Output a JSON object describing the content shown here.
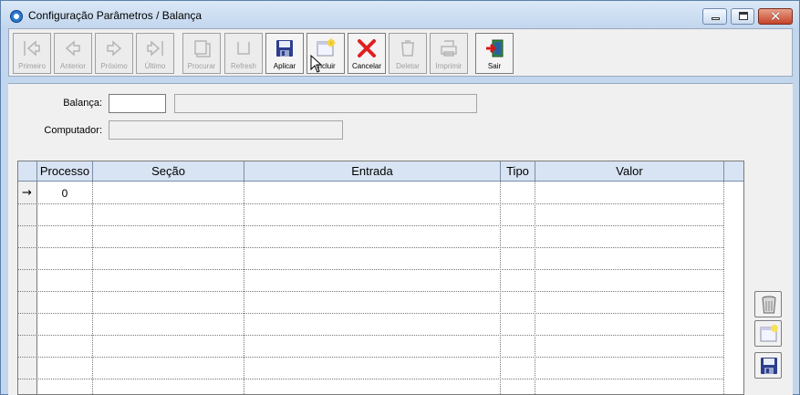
{
  "window": {
    "title": "Configuração Parâmetros / Balança"
  },
  "toolbar": {
    "buttons": [
      {
        "label": "Primeiro",
        "icon": "first-icon",
        "enabled": false
      },
      {
        "label": "Anterior",
        "icon": "previous-icon",
        "enabled": false
      },
      {
        "label": "Próximo",
        "icon": "next-icon",
        "enabled": false
      },
      {
        "label": "Último",
        "icon": "last-icon",
        "enabled": false
      },
      {
        "label": "Procurar",
        "icon": "search-icon",
        "enabled": false
      },
      {
        "label": "Refresh",
        "icon": "refresh-icon",
        "enabled": false
      },
      {
        "label": "Aplicar",
        "icon": "save-icon",
        "enabled": true
      },
      {
        "label": "Incluir",
        "icon": "new-record-icon",
        "enabled": true
      },
      {
        "label": "Cancelar",
        "icon": "cancel-icon",
        "enabled": true
      },
      {
        "label": "Deletar",
        "icon": "delete-icon",
        "enabled": false
      },
      {
        "label": "Imprimir",
        "icon": "print-icon",
        "enabled": false
      },
      {
        "label": "Sair",
        "icon": "exit-icon",
        "enabled": true
      }
    ]
  },
  "form": {
    "balanca_label": "Balança:",
    "balanca_value": "",
    "balanca_desc": "",
    "computador_label": "Computador:",
    "computador_value": ""
  },
  "grid": {
    "columns": [
      "Processo",
      "Seção",
      "Entrada",
      "Tipo",
      "Valor"
    ],
    "rows": [
      {
        "Processo": "0",
        "Seção": "",
        "Entrada": "",
        "Tipo": "",
        "Valor": ""
      }
    ],
    "current_row_marker": "→"
  },
  "side_buttons": [
    "trash-icon",
    "new-record-icon",
    "save-icon"
  ],
  "colors": {
    "title_bar": "#c2d6ee",
    "header_bg": "#d8e4f3",
    "close_button": "#c5432a"
  }
}
